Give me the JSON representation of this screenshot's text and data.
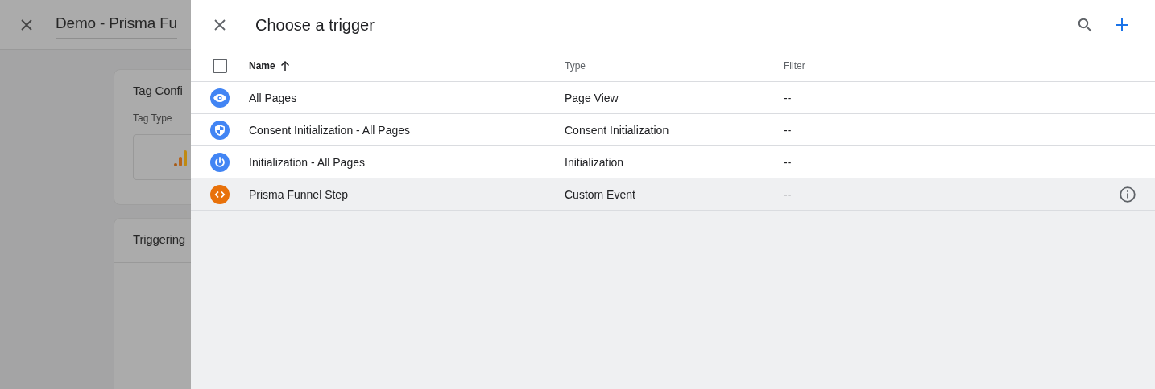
{
  "background_page": {
    "title": "Demo - Prisma Fu",
    "cards": [
      {
        "title": "Tag Confi",
        "field_label": "Tag Type"
      },
      {
        "title": "Triggering"
      }
    ]
  },
  "panel": {
    "title": "Choose a trigger",
    "table": {
      "select_all": {
        "checked": false
      },
      "columns": [
        {
          "label": "Name",
          "sorted": true
        },
        {
          "label": "Type",
          "sorted": false
        },
        {
          "label": "Filter",
          "sorted": false
        }
      ],
      "rows": [
        {
          "kind": "eye",
          "color": "#4285f4",
          "name": "All Pages",
          "type": "Page View",
          "filter": "--",
          "hovered": false
        },
        {
          "kind": "shield",
          "color": "#4285f4",
          "name": "Consent Initialization - All Pages",
          "type": "Consent Initialization",
          "filter": "--",
          "hovered": false
        },
        {
          "kind": "power",
          "color": "#4285f4",
          "name": "Initialization - All Pages",
          "type": "Initialization",
          "filter": "--",
          "hovered": false
        },
        {
          "kind": "code",
          "color": "#e8710a",
          "name": "Prisma Funnel Step",
          "type": "Custom Event",
          "filter": "--",
          "hovered": true
        }
      ]
    }
  }
}
